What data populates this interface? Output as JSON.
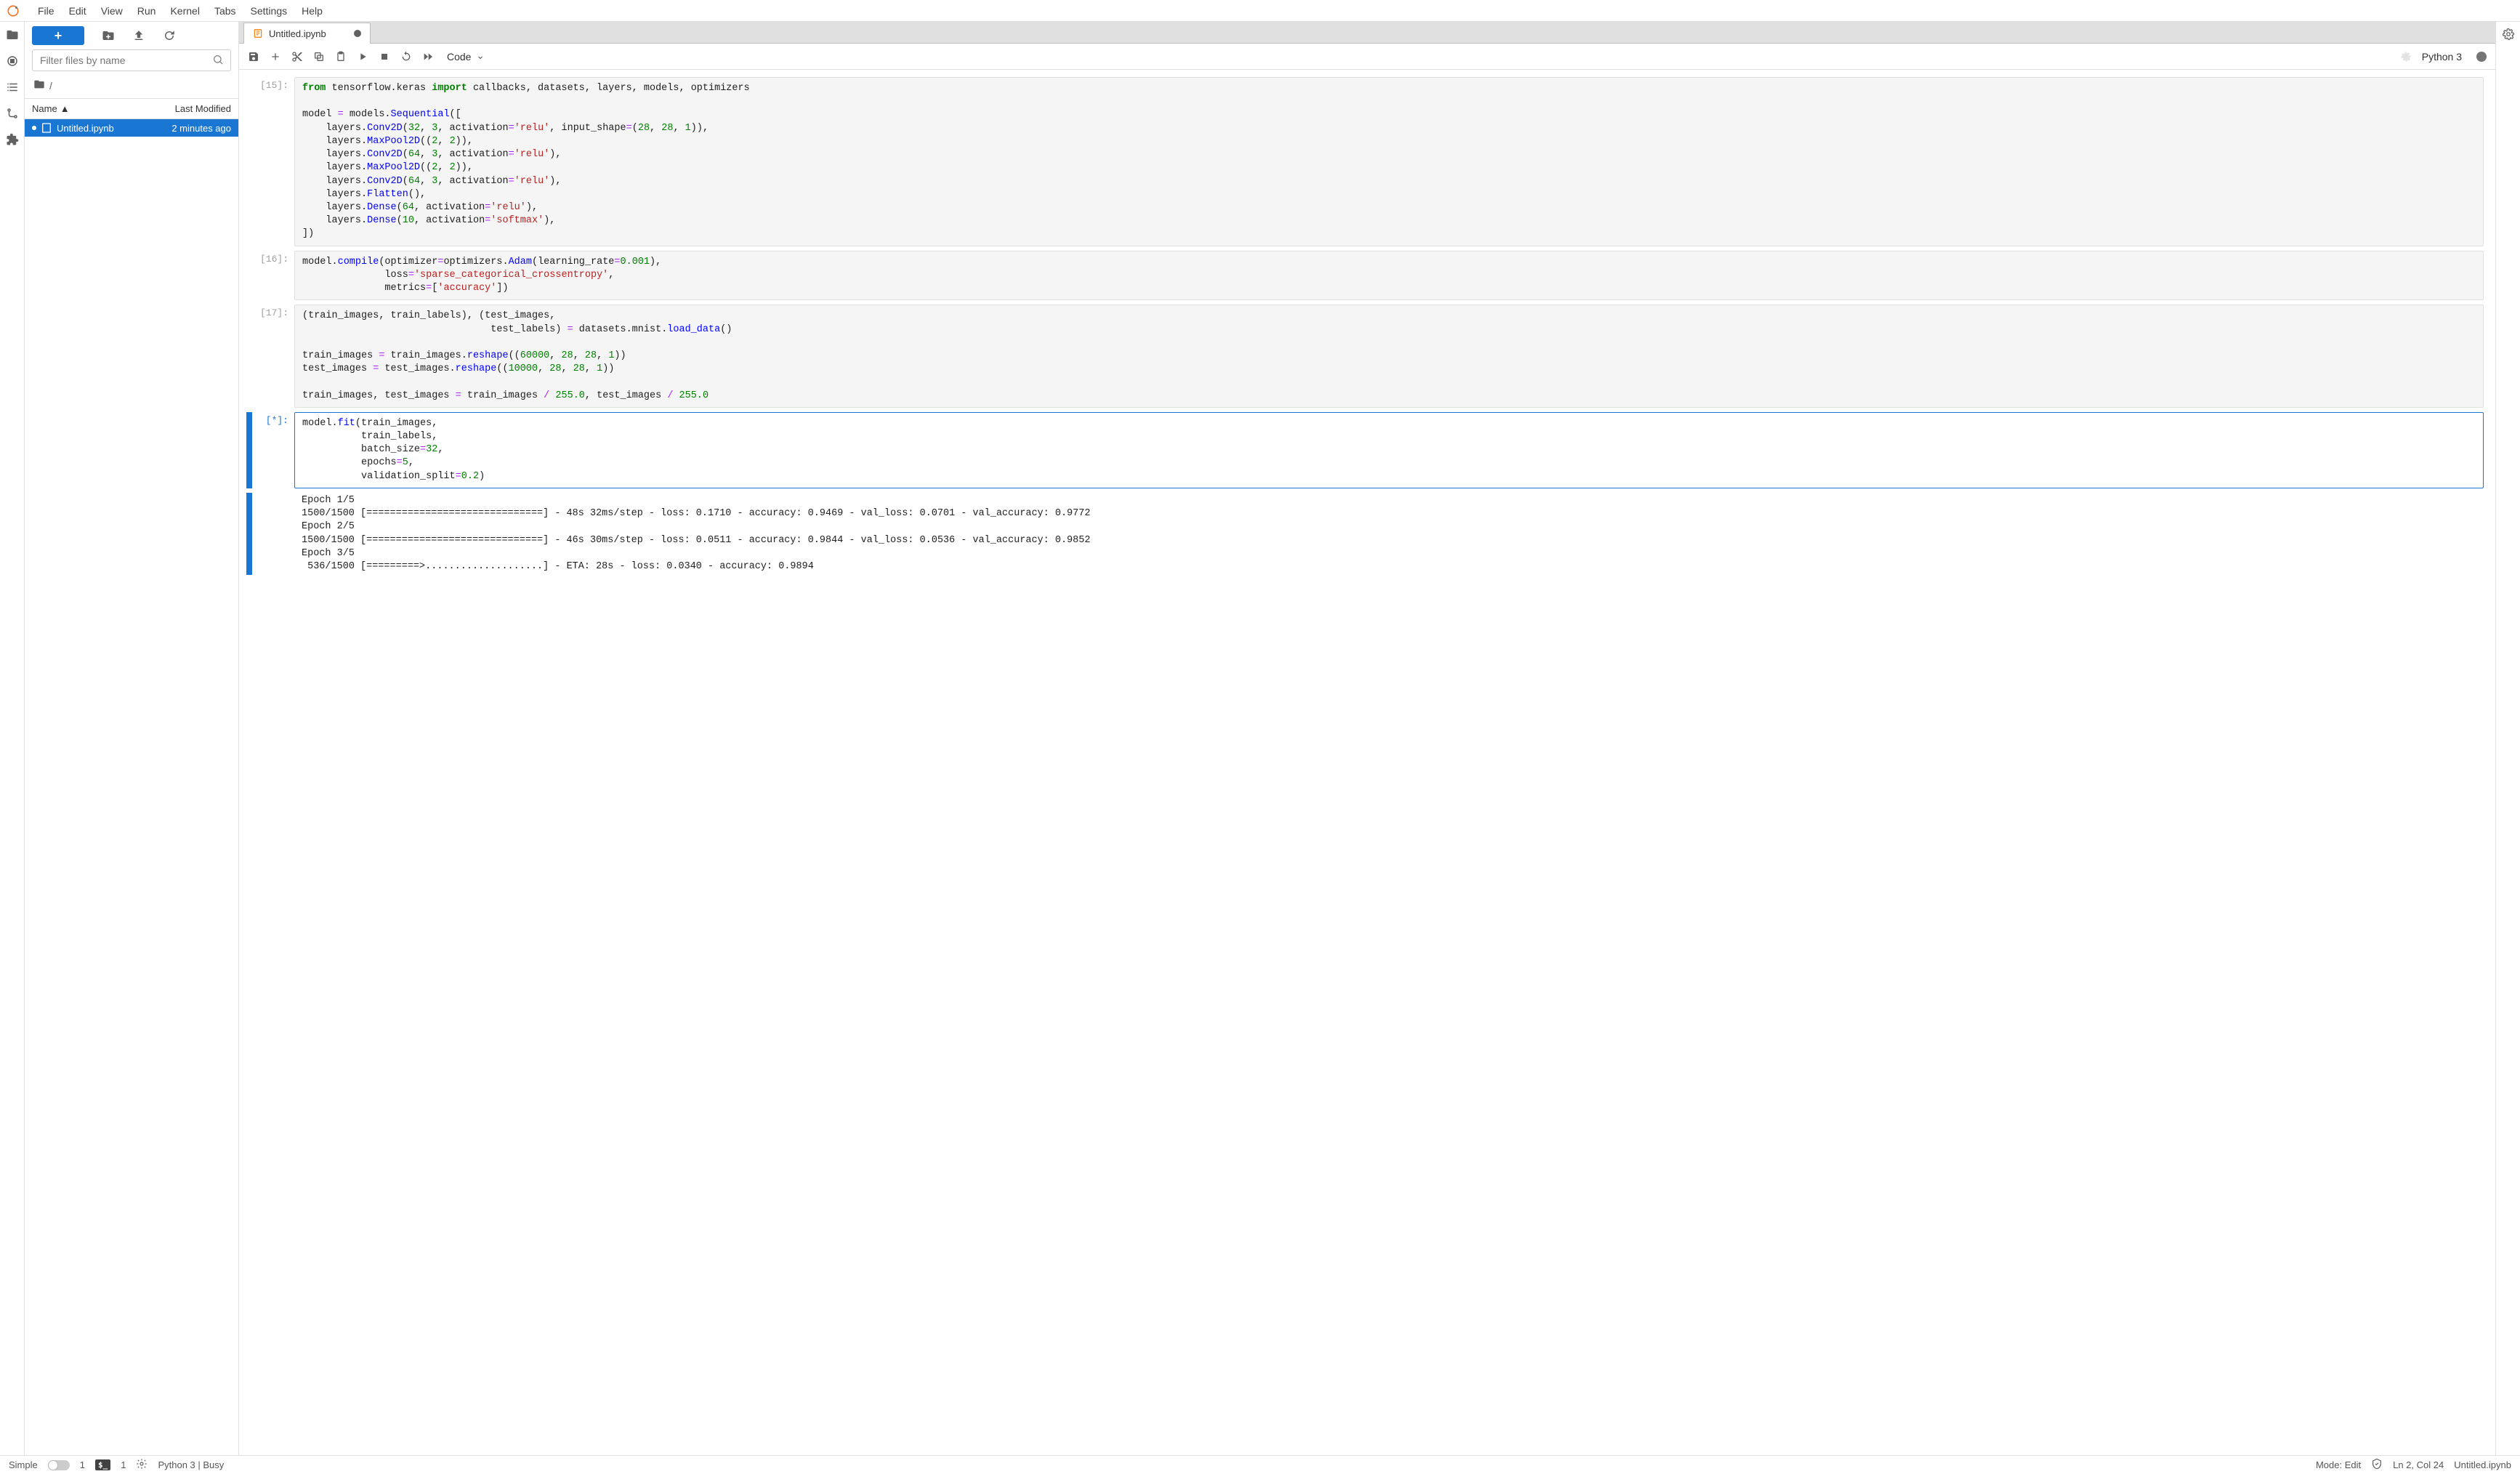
{
  "menu": [
    "File",
    "Edit",
    "View",
    "Run",
    "Kernel",
    "Tabs",
    "Settings",
    "Help"
  ],
  "sidebar": {
    "filter_placeholder": "Filter files by name",
    "breadcrumb": "/",
    "cols": {
      "name": "Name",
      "modified": "Last Modified"
    },
    "files": [
      {
        "name": "Untitled.ipynb",
        "modified": "2 minutes ago",
        "selected": true,
        "dirty": true
      }
    ]
  },
  "tab": {
    "title": "Untitled.ipynb",
    "dirty": true
  },
  "nb_toolbar": {
    "cell_type": "Code",
    "kernel": "Python 3"
  },
  "cells": [
    {
      "prompt": "[15]:",
      "html": "<span class='kw'>from</span> tensorflow.keras <span class='kw'>import</span> callbacks, datasets, layers, models, optimizers\n\nmodel <span class='op'>=</span> models.<span class='cls'>Sequential</span>([\n    layers.<span class='cls'>Conv2D</span>(<span class='num'>32</span>, <span class='num'>3</span>, activation<span class='op'>=</span><span class='str'>'relu'</span>, input_shape<span class='op'>=</span>(<span class='num'>28</span>, <span class='num'>28</span>, <span class='num'>1</span>)),\n    layers.<span class='cls'>MaxPool2D</span>((<span class='num'>2</span>, <span class='num'>2</span>)),\n    layers.<span class='cls'>Conv2D</span>(<span class='num'>64</span>, <span class='num'>3</span>, activation<span class='op'>=</span><span class='str'>'relu'</span>),\n    layers.<span class='cls'>MaxPool2D</span>((<span class='num'>2</span>, <span class='num'>2</span>)),\n    layers.<span class='cls'>Conv2D</span>(<span class='num'>64</span>, <span class='num'>3</span>, activation<span class='op'>=</span><span class='str'>'relu'</span>),\n    layers.<span class='cls'>Flatten</span>(),\n    layers.<span class='cls'>Dense</span>(<span class='num'>64</span>, activation<span class='op'>=</span><span class='str'>'relu'</span>),\n    layers.<span class='cls'>Dense</span>(<span class='num'>10</span>, activation<span class='op'>=</span><span class='str'>'softmax'</span>),\n])"
    },
    {
      "prompt": "[16]:",
      "html": "model.<span class='fn'>compile</span>(optimizer<span class='op'>=</span>optimizers.<span class='cls'>Adam</span>(learning_rate<span class='op'>=</span><span class='num'>0.001</span>),\n              loss<span class='op'>=</span><span class='str'>'sparse_categorical_crossentropy'</span>,\n              metrics<span class='op'>=</span>[<span class='str'>'accuracy'</span>])"
    },
    {
      "prompt": "[17]:",
      "html": "(train_images, train_labels), (test_images,\n                                test_labels) <span class='op'>=</span> datasets.mnist.<span class='fn'>load_data</span>()\n\ntrain_images <span class='op'>=</span> train_images.<span class='fn'>reshape</span>((<span class='num'>60000</span>, <span class='num'>28</span>, <span class='num'>28</span>, <span class='num'>1</span>))\ntest_images <span class='op'>=</span> test_images.<span class='fn'>reshape</span>((<span class='num'>10000</span>, <span class='num'>28</span>, <span class='num'>28</span>, <span class='num'>1</span>))\n\ntrain_images, test_images <span class='op'>=</span> train_images <span class='op'>/</span> <span class='num'>255.0</span>, test_images <span class='op'>/</span> <span class='num'>255.0</span>"
    },
    {
      "prompt": "[*]:",
      "active": true,
      "html": "model.<span class='fn'>fit</span>(train_images,\n          train_labels,\n          batch_size<span class='op'>=</span><span class='num'>32</span>,\n          epochs<span class='op'>=</span><span class='num'>5</span>,\n          validation_split<span class='op'>=</span><span class='num'>0.2</span>)"
    }
  ],
  "output": "Epoch 1/5\n1500/1500 [==============================] - 48s 32ms/step - loss: 0.1710 - accuracy: 0.9469 - val_loss: 0.0701 - val_accuracy: 0.9772\nEpoch 2/5\n1500/1500 [==============================] - 46s 30ms/step - loss: 0.0511 - accuracy: 0.9844 - val_loss: 0.0536 - val_accuracy: 0.9852\nEpoch 3/5\n 536/1500 [=========>....................] - ETA: 28s - loss: 0.0340 - accuracy: 0.9894",
  "statusbar": {
    "simple": "Simple",
    "term_count": "1",
    "term2_count": "1",
    "kernel": "Python 3 | Busy",
    "mode": "Mode: Edit",
    "pos": "Ln 2, Col 24",
    "file": "Untitled.ipynb"
  }
}
